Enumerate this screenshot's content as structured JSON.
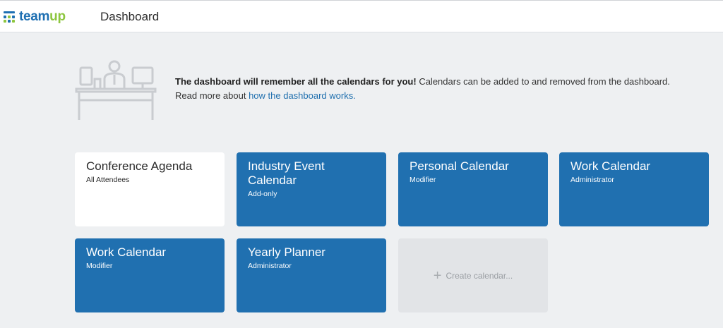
{
  "app": {
    "logo_part1": "team",
    "logo_part2": "up",
    "page_title": "Dashboard"
  },
  "info": {
    "bold_text": "The dashboard will remember all the calendars for you!",
    "text": " Calendars can be added to and removed from the dashboard.",
    "read_more_prefix": "Read more about ",
    "link_text": "how the dashboard works."
  },
  "calendars": [
    {
      "name": "Conference Agenda",
      "role": "All Attendees"
    },
    {
      "name": "Industry Event Calendar",
      "role": "Add-only"
    },
    {
      "name": "Personal Calendar",
      "role": "Modifier"
    },
    {
      "name": "Work Calendar",
      "role": "Administrator"
    },
    {
      "name": "Work Calendar",
      "role": "Modifier"
    },
    {
      "name": "Yearly Planner",
      "role": "Administrator"
    }
  ],
  "create_calendar": {
    "label": "Create calendar..."
  },
  "colors": {
    "brand_blue": "#1e6fb2",
    "brand_green": "#8dc63f",
    "card_blue": "#2070b0",
    "link": "#1f6fae"
  }
}
